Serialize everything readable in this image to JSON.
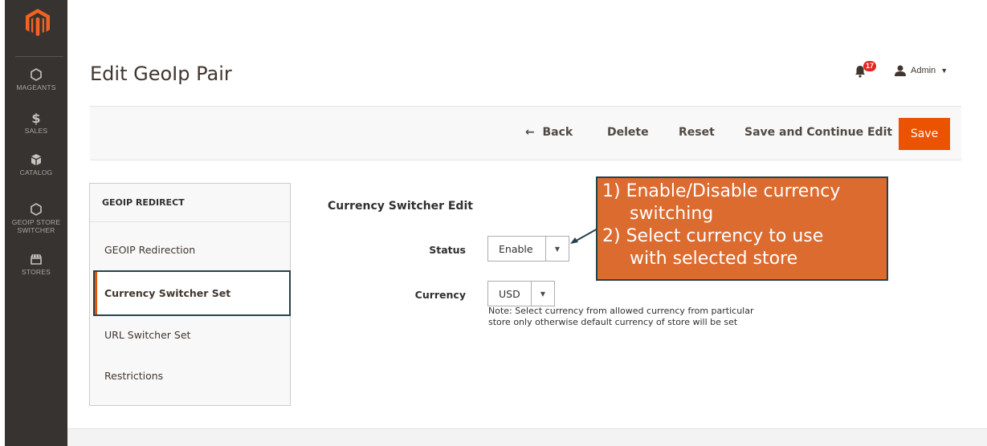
{
  "sidebar": {
    "items": [
      {
        "label": "MAGEANTS",
        "icon": "hexagon-icon"
      },
      {
        "label": "SALES",
        "icon": "dollar-icon"
      },
      {
        "label": "CATALOG",
        "icon": "box-icon"
      },
      {
        "label": "GEOIP STORE SWITCHER",
        "icon": "hexagon-icon"
      },
      {
        "label": "STORES",
        "icon": "store-icon"
      }
    ]
  },
  "header": {
    "title": "Edit GeoIp Pair",
    "notifications_count": "17",
    "user_label": "Admin"
  },
  "toolbar": {
    "back_label": "Back",
    "delete_label": "Delete",
    "reset_label": "Reset",
    "save_continue_label": "Save and Continue Edit",
    "save_label": "Save"
  },
  "tabs": {
    "heading": "GEOIP REDIRECT",
    "items": [
      {
        "label": "GEOIP Redirection"
      },
      {
        "label": "Currency Switcher Set"
      },
      {
        "label": "URL Switcher Set"
      },
      {
        "label": "Restrictions"
      }
    ]
  },
  "form": {
    "section_title": "Currency Switcher Edit",
    "status_label": "Status",
    "status_value": "Enable",
    "currency_label": "Currency",
    "currency_value": "USD",
    "note_line1": "Note: Select currency from allowed currency from particular",
    "note_line2": "store only otherwise default currency of store will be set"
  },
  "callout": {
    "line1": "1) Enable/Disable currency",
    "line1b": "switching",
    "line2": "2) Select currency to use",
    "line2b": "with selected store"
  },
  "colors": {
    "accent": "#eb5202",
    "sidebar_bg": "#373330",
    "callout_bg": "#dc6b2f",
    "callout_border": "#24424e"
  }
}
